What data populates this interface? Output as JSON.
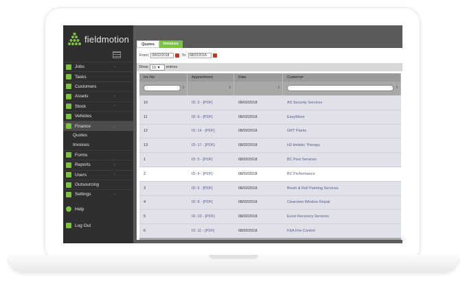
{
  "app": {
    "logo_text": "fieldmotion"
  },
  "sidebar": {
    "items": [
      {
        "label": "Jobs",
        "icon": "calendar-icon",
        "chevron": "‹"
      },
      {
        "label": "Tasks",
        "icon": "clipboard-icon",
        "chevron": ""
      },
      {
        "label": "Customers",
        "icon": "user-icon",
        "chevron": ""
      },
      {
        "label": "Assets",
        "icon": "wrench-icon",
        "chevron": "‹"
      },
      {
        "label": "Stock",
        "icon": "box-icon",
        "chevron": "‹"
      },
      {
        "label": "Vehicles",
        "icon": "truck-icon",
        "chevron": ""
      },
      {
        "label": "Finance",
        "icon": "card-icon",
        "chevron": "⌄"
      }
    ],
    "finance_sub": [
      "Quotes",
      "Invoices"
    ],
    "items2": [
      {
        "label": "Forms",
        "icon": "form-icon",
        "chevron": ""
      },
      {
        "label": "Reports",
        "icon": "chart-icon",
        "chevron": "‹"
      },
      {
        "label": "Users",
        "icon": "users-icon",
        "chevron": "‹"
      },
      {
        "label": "Outsourcing",
        "icon": "outsourcing-icon",
        "chevron": ""
      },
      {
        "label": "Settings",
        "icon": "tools-icon",
        "chevron": "‹"
      }
    ],
    "help": "Help",
    "logout": "Log Out"
  },
  "tabs": {
    "quotes": "Quotes",
    "invoices": "Invoices"
  },
  "filters": {
    "from_label": "From:",
    "from_value": "08/02/2018",
    "to_label": "To:",
    "to_value": "08/02/2018",
    "show_label": "Show",
    "show_value": "10",
    "entries_label": "entries"
  },
  "table": {
    "headers": [
      "Inv No.",
      "Appointment",
      "Date",
      "Customer"
    ],
    "rows": [
      {
        "inv": "10",
        "appt": "ID: 3 - [PDF]",
        "date": "08/02/2018",
        "customer": "AS Security Services"
      },
      {
        "inv": "11",
        "appt": "ID: 9 - [PDF]",
        "date": "08/02/2018",
        "customer": "EasyMove"
      },
      {
        "inv": "12",
        "appt": "ID: 14 - [PDF]",
        "date": "08/02/2018",
        "customer": "GRT Paints"
      },
      {
        "inv": "13",
        "appt": "ID: 17 - [PDF]",
        "date": "08/02/2018",
        "customer": "H2 Holistic Therapy"
      },
      {
        "inv": "1",
        "appt": "ID: 5 - [PDF]",
        "date": "08/02/2018",
        "customer": "BC Pest Services"
      },
      {
        "inv": "2",
        "appt": "ID: 4 - [PDF]",
        "date": "08/02/2018",
        "customer": "BC Performance"
      },
      {
        "inv": "3",
        "appt": "ID: 6 - [PDF]",
        "date": "08/02/2018",
        "customer": "Brush & Roll Painting Services"
      },
      {
        "inv": "4",
        "appt": "ID: 8 - [PDF]",
        "date": "08/02/2018",
        "customer": "Clearview Window Repair"
      },
      {
        "inv": "5",
        "appt": "ID: 10 - [PDF]",
        "date": "08/02/2018",
        "customer": "Excel Recovery Services"
      },
      {
        "inv": "6",
        "appt": "ID: 11 - [PDF]",
        "date": "08/02/2018",
        "customer": "F&A Fire Control"
      }
    ]
  },
  "colors": {
    "accent": "#7ec242",
    "sidebar_bg": "#2f2f2f",
    "link": "#555a8a"
  }
}
